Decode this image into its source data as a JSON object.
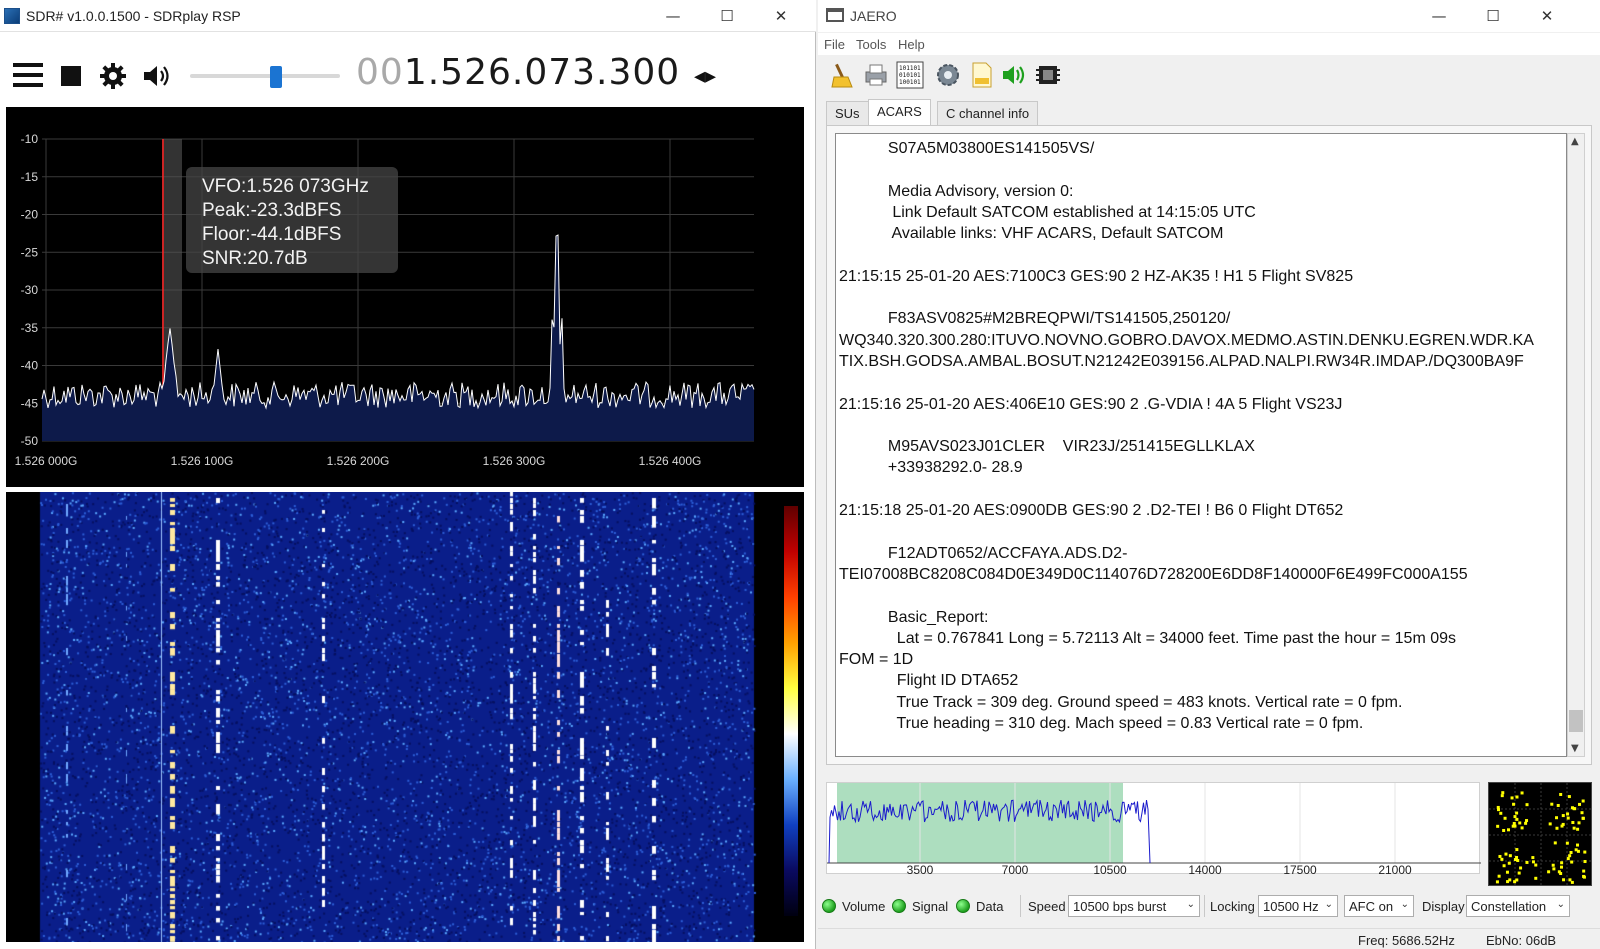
{
  "sdr": {
    "window_title": "SDR# v1.0.0.1500 - SDRplay RSP",
    "window_controls": {
      "minimize": "—",
      "maximize": "☐",
      "close": "✕"
    },
    "frequency_prefix": "00",
    "frequency_main": "1.526.073.300",
    "frequency_arrows": "◂▸",
    "volume_level": 0.58,
    "vfo_info": {
      "vfo": "VFO:1.526 073GHz",
      "peak": "Peak:-23.3dBFS",
      "floor": "Floor:-44.1dBFS",
      "snr": "SNR:20.7dB"
    },
    "spectrum_y_ticks": [
      "-10",
      "-15",
      "-20",
      "-25",
      "-30",
      "-35",
      "-40",
      "-45",
      "-50"
    ],
    "spectrum_x_ticks": [
      "1.526 000G",
      "1.526 100G",
      "1.526 200G",
      "1.526 300G",
      "1.526 400G"
    ],
    "spectrum_colors": {
      "trace": "#ffffff",
      "vfo_line": "#ff2020",
      "background": "#000000",
      "fill": "#0d1a4a"
    }
  },
  "jaero": {
    "window_title": "JAERO",
    "window_controls": {
      "minimize": "—",
      "maximize": "☐",
      "close": "✕"
    },
    "menu": [
      "File",
      "Tools",
      "Help"
    ],
    "toolbar_icons": [
      "broom-icon",
      "printer-icon",
      "binary-icon",
      "settings-icon",
      "log-icon",
      "volume-icon",
      "chip-icon"
    ],
    "tabs": [
      "SUs",
      "ACARS",
      "C channel info"
    ],
    "active_tab": "ACARS",
    "messages": [
      "           S07A5M03800ES141505VS/",
      "",
      "           Media Advisory, version 0:",
      "            Link Default SATCOM established at 14:15:05 UTC",
      "            Available links: VHF ACARS, Default SATCOM",
      "",
      "21:15:15 25-01-20 AES:7100C3 GES:90 2 HZ-AK35 ! H1 5 Flight SV825",
      "",
      "           F83ASV0825#M2BREQPWI/TS141505,250120/",
      "WQ340.320.300.280:ITUVO.NOVNO.GOBRO.DAVOX.MEDMO.ASTIN.DENKU.EGREN.WDR.KA",
      "TIX.BSH.GODSA.AMBAL.BOSUT.N21242E039156.ALPAD.NALPI.RW34R.IMDAP./DQ300BA9F",
      "",
      "21:15:16 25-01-20 AES:406E10 GES:90 2 .G-VDIA ! 4A 5 Flight VS23J",
      "",
      "           M95AVS023J01CLER    VIR23J/251415EGLLKLAX",
      "           +33938292.0- 28.9",
      "",
      "21:15:18 25-01-20 AES:0900DB GES:90 2 .D2-TEI ! B6 0 Flight DT652",
      "",
      "           F12ADT0652/ACCFAYA.ADS.D2-",
      "TEI07008BC8208C084D0E349D0C114076D728200E6DD8F140000F6E499FC000A155",
      "",
      "           Basic_Report:",
      "             Lat = 0.767841 Long = 5.72113 Alt = 34000 feet. Time past the hour = 15m 09s",
      "FOM = 1D",
      "             Flight ID DTA652",
      "             True Track = 309 deg. Ground speed = 483 knots. Vertical rate = 0 fpm.",
      "             True heading = 310 deg. Mach speed = 0.83 Vertical rate = 0 fpm."
    ],
    "spectrum_x_ticks": [
      "3500",
      "7000",
      "10500",
      "14000",
      "17500",
      "21000"
    ],
    "indicators": [
      "Volume",
      "Signal",
      "Data"
    ],
    "speed_label": "Speed",
    "speed_value": "10500 bps burst",
    "locking_label": "Locking",
    "locking_value": "10500 Hz",
    "afc_value": "AFC on",
    "display_label": "Display",
    "display_value": "Constellation",
    "status_freq": "Freq: 5686.52Hz",
    "status_ebno": "EbNo: 06dB",
    "colors": {
      "signal_trace": "#1a1acc",
      "passband": "#9fd8b4",
      "led": "#22b022",
      "constellation": "#ffff00"
    }
  }
}
